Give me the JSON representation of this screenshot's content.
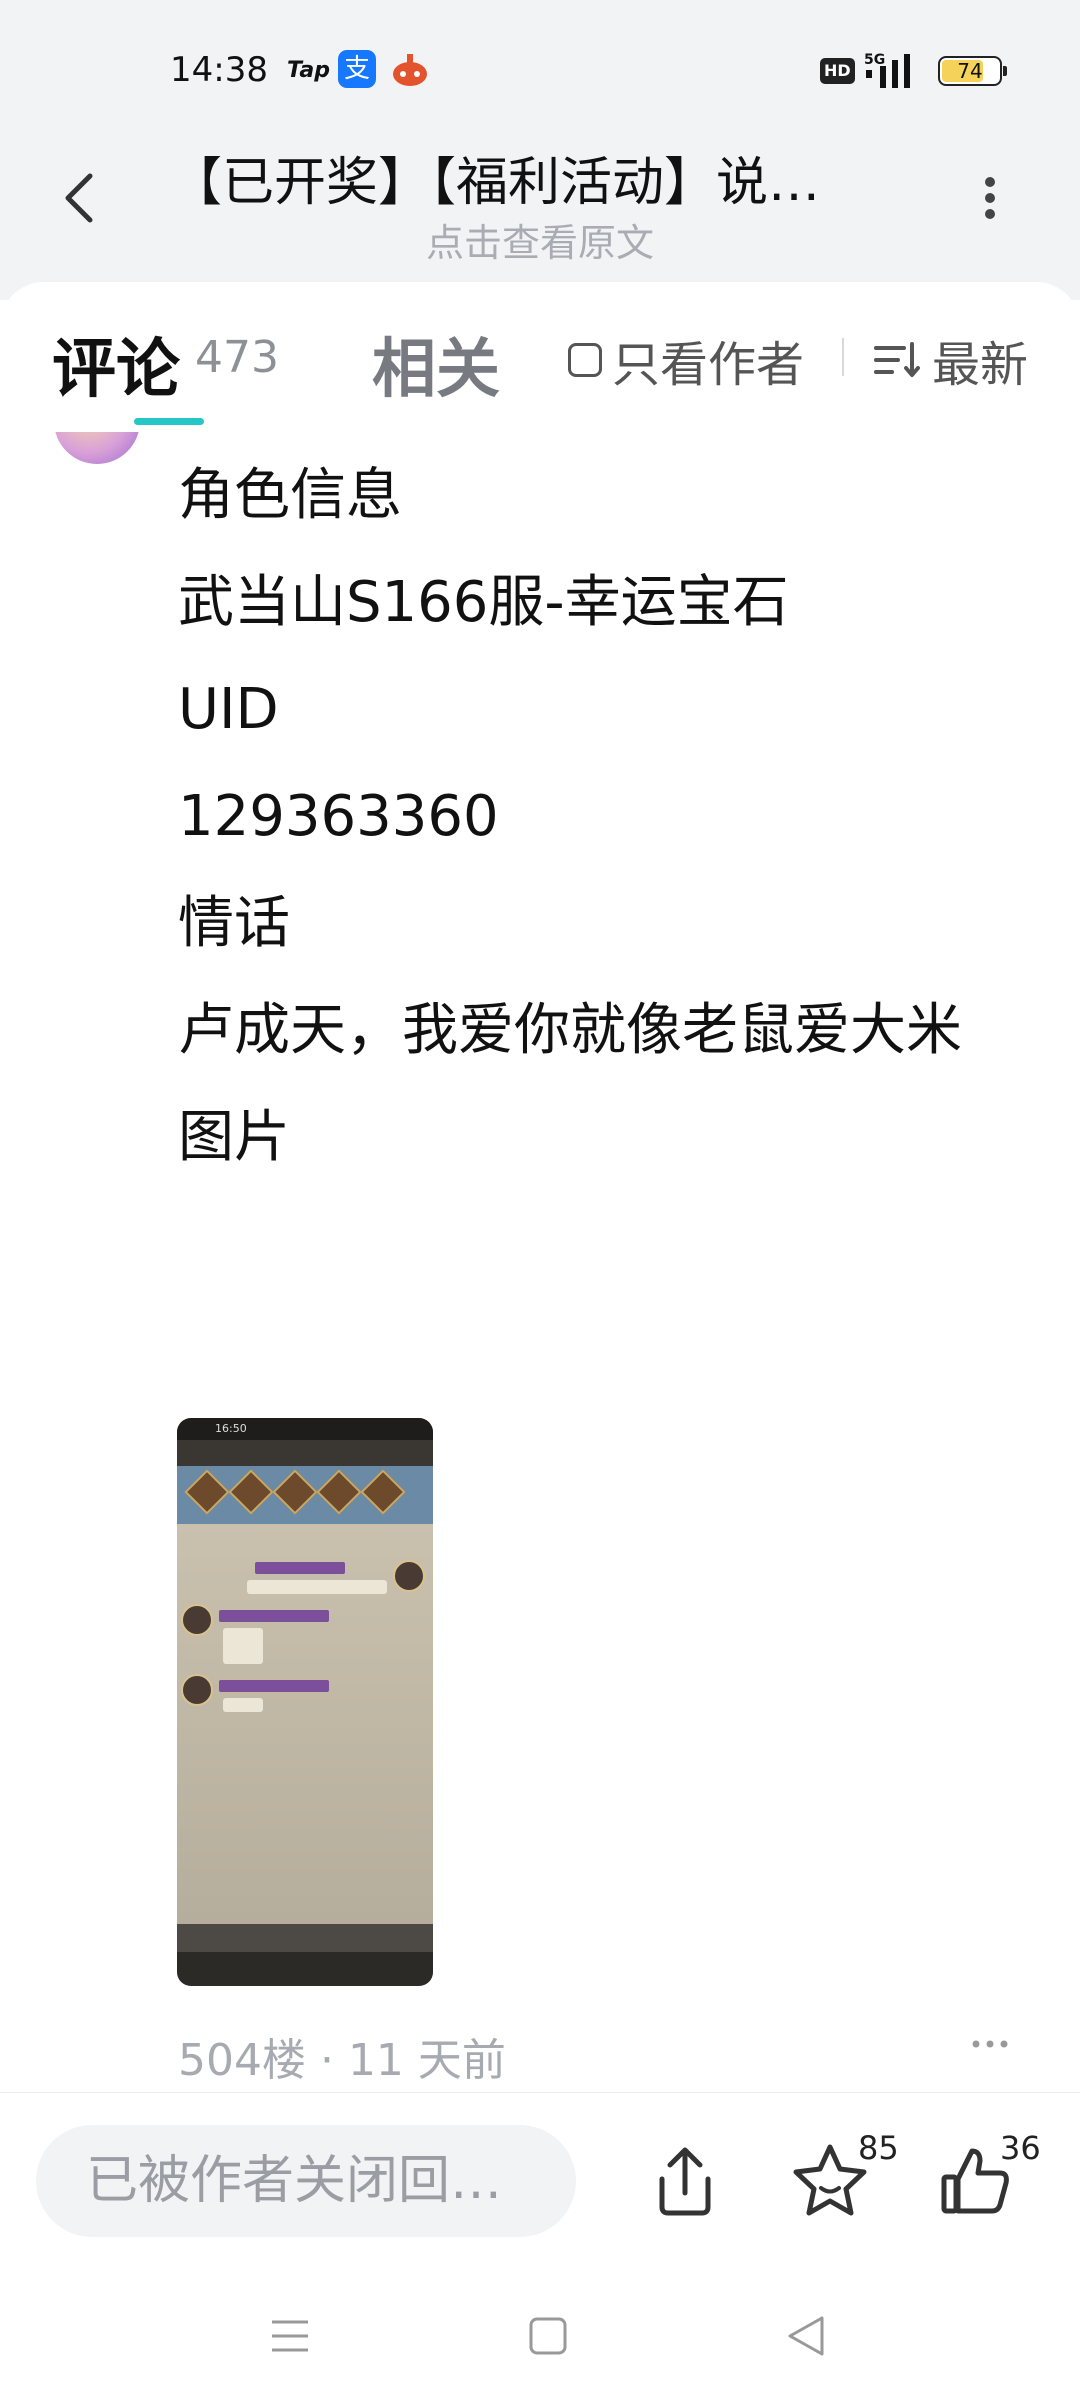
{
  "status_bar": {
    "time": "14:38",
    "tap_label": "Tap",
    "alipay_glyph": "支",
    "hd_label": "HD",
    "network": "5G",
    "battery": "74",
    "battery_level": 0.74
  },
  "header": {
    "title": "【已开奖】【福利活动】说…",
    "subtitle": "点击查看原文"
  },
  "tabs": {
    "comments_label": "评论",
    "comments_count": "473",
    "related_label": "相关",
    "author_only_label": "只看作者",
    "sort_label": "最新"
  },
  "comment": {
    "lines": [
      "角色信息",
      "武当山S166服-幸运宝石",
      "UID",
      "129363360",
      "情话",
      "卢成天，我爱你就像老鼠爱大米",
      "图片"
    ],
    "image_time": "16:50",
    "meta": "504楼 · 11 天前"
  },
  "bottom_bar": {
    "reply_placeholder": "已被作者关闭回…",
    "favorites_count": "85",
    "likes_count": "36"
  },
  "colors": {
    "accent": "#24c6c8",
    "header_bg": "#f1f3f5"
  },
  "icons": [
    "back-icon",
    "more-vertical-icon",
    "checkbox-icon",
    "sort-icon",
    "share-icon",
    "star-face-icon",
    "thumbs-up-icon",
    "menu-icon",
    "home-icon",
    "back-triangle-icon"
  ]
}
